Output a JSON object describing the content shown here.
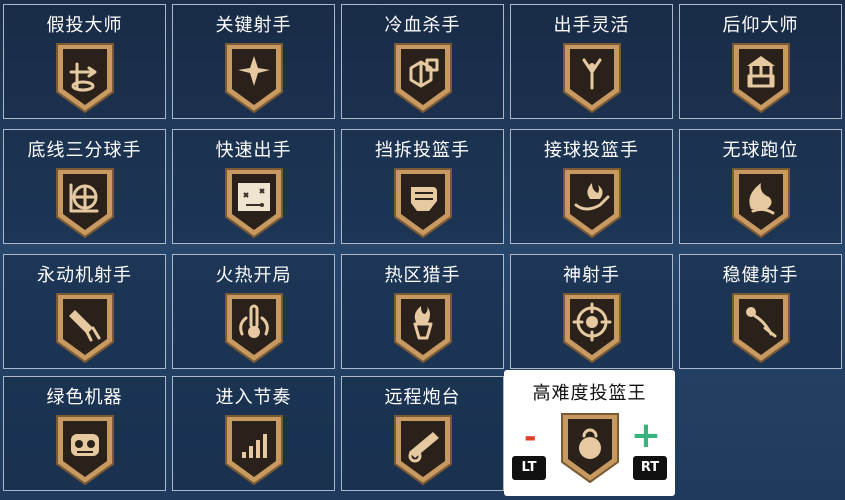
{
  "badges": [
    {
      "label": "假投大师",
      "icon": "pump-fake-icon"
    },
    {
      "label": "关键射手",
      "icon": "star-burst-icon"
    },
    {
      "label": "冷血杀手",
      "icon": "ice-cubes-icon"
    },
    {
      "label": "出手灵活",
      "icon": "slingshot-icon"
    },
    {
      "label": "后仰大师",
      "icon": "wishing-well-icon"
    },
    {
      "label": "底线三分球手",
      "icon": "corner-ball-icon"
    },
    {
      "label": "快速出手",
      "icon": "play-diagram-icon"
    },
    {
      "label": "挡拆投篮手",
      "icon": "fist-icon"
    },
    {
      "label": "接球投篮手",
      "icon": "flaming-hand-icon"
    },
    {
      "label": "无球跑位",
      "icon": "flame-swoosh-icon"
    },
    {
      "label": "永动机射手",
      "icon": "rocket-icon"
    },
    {
      "label": "火热开局",
      "icon": "thermometer-icon"
    },
    {
      "label": "热区猎手",
      "icon": "flaming-hoop-icon"
    },
    {
      "label": "神射手",
      "icon": "crosshair-skull-icon"
    },
    {
      "label": "稳健射手",
      "icon": "arcing-ball-icon"
    },
    {
      "label": "绿色机器",
      "icon": "robot-icon"
    },
    {
      "label": "进入节奏",
      "icon": "rising-bars-icon"
    },
    {
      "label": "远程炮台",
      "icon": "cannon-icon"
    }
  ],
  "selected": {
    "label": "高难度投篮王",
    "icon": "kettlebell-icon",
    "minus": "-",
    "plus": "+",
    "left_trigger": "LT",
    "right_trigger": "RT"
  },
  "colors": {
    "badge_gold": "#c89a62",
    "badge_dark": "#2a211a",
    "minus_red": "#e0402a",
    "plus_green": "#36b37e"
  }
}
